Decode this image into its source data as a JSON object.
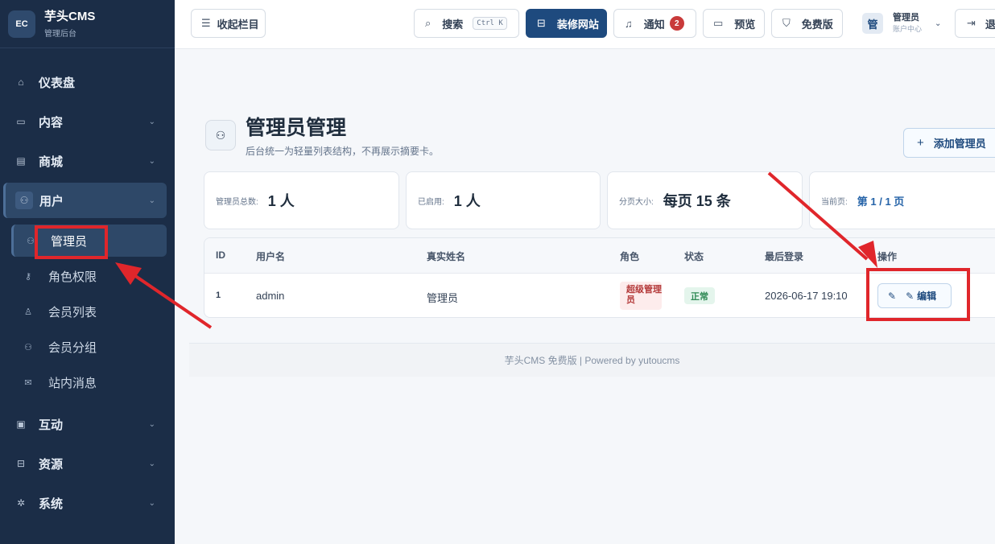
{
  "brand": {
    "logo": "EC",
    "name": "芋头CMS",
    "subtitle": "管理后台"
  },
  "sidebar": {
    "items": [
      {
        "label": "仪表盘",
        "icon": "home-icon"
      },
      {
        "label": "内容",
        "icon": "folder-icon"
      },
      {
        "label": "商城",
        "icon": "store-icon"
      },
      {
        "label": "用户",
        "icon": "users-icon"
      },
      {
        "label": "互动",
        "icon": "chat-icon"
      },
      {
        "label": "资源",
        "icon": "layout-icon"
      },
      {
        "label": "系统",
        "icon": "settings-icon"
      }
    ],
    "sub_items": [
      {
        "label": "管理员",
        "icon": "user-admin-icon"
      },
      {
        "label": "角色权限",
        "icon": "key-icon"
      },
      {
        "label": "会员列表",
        "icon": "user-icon"
      },
      {
        "label": "会员分组",
        "icon": "users-group-icon"
      },
      {
        "label": "站内消息",
        "icon": "mail-icon"
      }
    ]
  },
  "topbar": {
    "collapse_label": "收起栏目",
    "search_label": "搜索",
    "search_shortcut": "Ctrl K",
    "decorate_label": "装修网站",
    "notify_label": "通知",
    "notify_count": "2",
    "preview_label": "预览",
    "edition_label": "免费版",
    "user_avatar": "管",
    "user_name": "管理员",
    "user_sub": "账户中心",
    "logout_label": "退"
  },
  "page": {
    "title": "管理员管理",
    "subtitle": "后台统一为轻量列表结构，不再展示摘要卡。",
    "add_button": "添加管理员"
  },
  "stats": [
    {
      "label": "管理员总数:",
      "value": "1 人"
    },
    {
      "label": "已启用:",
      "value": "1 人"
    },
    {
      "label": "分页大小:",
      "value": "每页 15 条"
    },
    {
      "label": "当前页:",
      "value": "第 1 / 1 页"
    }
  ],
  "table": {
    "headers": [
      "ID",
      "用户名",
      "真实姓名",
      "角色",
      "状态",
      "最后登录",
      "操作"
    ],
    "rows": [
      {
        "id": "1",
        "username": "admin",
        "realname": "管理员",
        "role": "超级管理员",
        "status": "正常",
        "last_login": "2026-06-17 19:10",
        "action": "编辑"
      }
    ]
  },
  "footer": "芋头CMS 免费版 | Powered by yutoucms",
  "colors": {
    "sidebar": "#1b2d47",
    "primary": "#1e4a7e",
    "highlight": "#e0262b"
  }
}
